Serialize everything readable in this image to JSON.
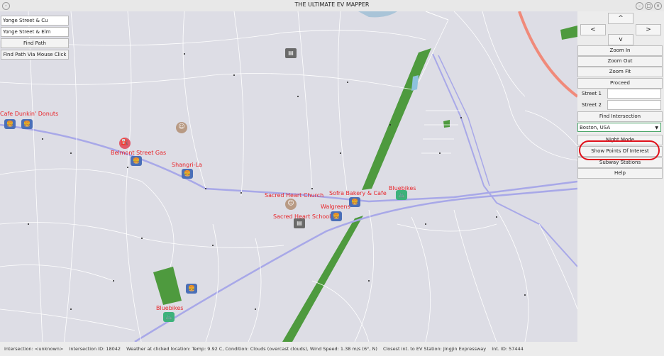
{
  "window": {
    "title": "THE ULTIMATE EV MAPPER"
  },
  "left_panel": {
    "street1_value": "Yonge Street & Cu",
    "street2_value": "Yonge Street & Elm",
    "find_path_label": "Find Path",
    "find_path_mouse_label": "Find Path Via Mouse Click"
  },
  "right_panel": {
    "arrow_up": "^",
    "arrow_left": "<",
    "arrow_right": ">",
    "arrow_down": "v",
    "zoom_in": "Zoom In",
    "zoom_out": "Zoom Out",
    "zoom_fit": "Zoom Fit",
    "proceed": "Proceed",
    "street1_label": "Street 1",
    "street2_label": "Street 2",
    "find_intersection": "Find Intersection",
    "city_selected": "Boston, USA",
    "night_mode": "Night Mode",
    "show_poi": "Show Points Of Interest",
    "subway_stations": "Subway Stations",
    "help": "Help"
  },
  "map": {
    "pois": [
      {
        "label": "Cafe Dunkin' Donuts",
        "type": "food"
      },
      {
        "label": "Belmont Street Gas",
        "type": "food"
      },
      {
        "label": "Shangri-La",
        "type": "food"
      },
      {
        "label": "Sacred Heart Church",
        "type": "person"
      },
      {
        "label": "Sofra Bakery & Cafe",
        "type": "food"
      },
      {
        "label": "Bluebikes",
        "type": "bike"
      },
      {
        "label": "Walgreens",
        "type": "food"
      },
      {
        "label": "Sacred Heart School",
        "type": "school"
      },
      {
        "label": "Bluebikes",
        "type": "bike"
      }
    ]
  },
  "status": {
    "intersection": "Intersection: <unknown>",
    "intersection_id": "Intersection ID: 18042",
    "weather": "Weather at clicked location: Temp: 9.92 C, Condition: Clouds (overcast clouds), Wind Speed: 1.38 m/s (6°, N)",
    "closest_ev": "Closest int. to EV Station: Jingjin Expressway",
    "int_id": "Int. ID: 57444"
  },
  "colors": {
    "map_bg": "#dddde5",
    "park": "#4e9a3e",
    "road_major": "#a8a8e8",
    "poi_label": "#e8252a",
    "highlight": "#e0101a"
  }
}
